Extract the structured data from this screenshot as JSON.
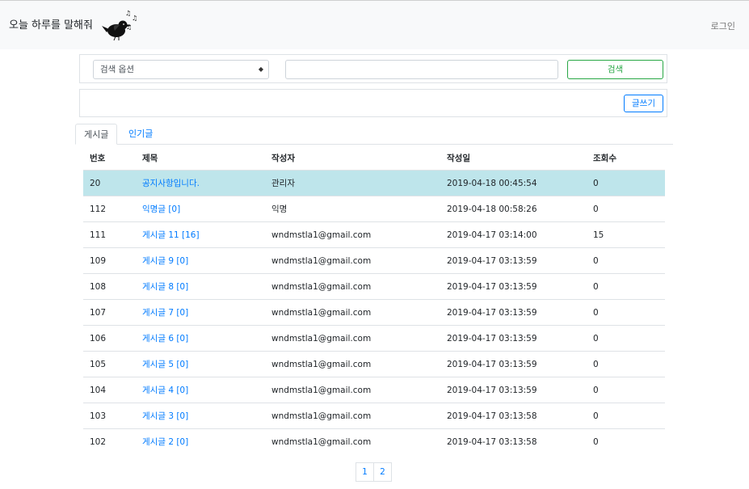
{
  "header": {
    "brand": "오늘 하루를 말해줘",
    "login_label": "로그인"
  },
  "search": {
    "option_label": "검색 옵션",
    "button_label": "검색",
    "input_value": ""
  },
  "write_button_label": "글쓰기",
  "tabs": [
    {
      "label": "게시글",
      "active": true
    },
    {
      "label": "인기글",
      "active": false
    }
  ],
  "table": {
    "headers": [
      "번호",
      "제목",
      "작성자",
      "작성일",
      "조회수"
    ],
    "rows": [
      {
        "no": "20",
        "title": "공지사항입니다.",
        "author": "관리자",
        "date": "2019-04-18 00:45:54",
        "views": "0",
        "notice": true
      },
      {
        "no": "112",
        "title": "익명글 [0]",
        "author": "익명",
        "date": "2019-04-18 00:58:26",
        "views": "0"
      },
      {
        "no": "111",
        "title": "게시글 11 [16]",
        "author": "wndmstla1@gmail.com",
        "date": "2019-04-17 03:14:00",
        "views": "15"
      },
      {
        "no": "109",
        "title": "게시글 9 [0]",
        "author": "wndmstla1@gmail.com",
        "date": "2019-04-17 03:13:59",
        "views": "0"
      },
      {
        "no": "108",
        "title": "게시글 8 [0]",
        "author": "wndmstla1@gmail.com",
        "date": "2019-04-17 03:13:59",
        "views": "0"
      },
      {
        "no": "107",
        "title": "게시글 7 [0]",
        "author": "wndmstla1@gmail.com",
        "date": "2019-04-17 03:13:59",
        "views": "0"
      },
      {
        "no": "106",
        "title": "게시글 6 [0]",
        "author": "wndmstla1@gmail.com",
        "date": "2019-04-17 03:13:59",
        "views": "0"
      },
      {
        "no": "105",
        "title": "게시글 5 [0]",
        "author": "wndmstla1@gmail.com",
        "date": "2019-04-17 03:13:59",
        "views": "0"
      },
      {
        "no": "104",
        "title": "게시글 4 [0]",
        "author": "wndmstla1@gmail.com",
        "date": "2019-04-17 03:13:59",
        "views": "0"
      },
      {
        "no": "103",
        "title": "게시글 3 [0]",
        "author": "wndmstla1@gmail.com",
        "date": "2019-04-17 03:13:58",
        "views": "0"
      },
      {
        "no": "102",
        "title": "게시글 2 [0]",
        "author": "wndmstla1@gmail.com",
        "date": "2019-04-17 03:13:58",
        "views": "0"
      }
    ]
  },
  "pagination": [
    "1",
    "2"
  ],
  "colors": {
    "link": "#007bff",
    "success": "#28a745",
    "notice_row": "#bee5eb",
    "navbar_bg": "#f8f9fa"
  },
  "icons": {
    "logo": "bird-with-music-notes-icon",
    "select_arrows": "up-down-caret-icon"
  }
}
